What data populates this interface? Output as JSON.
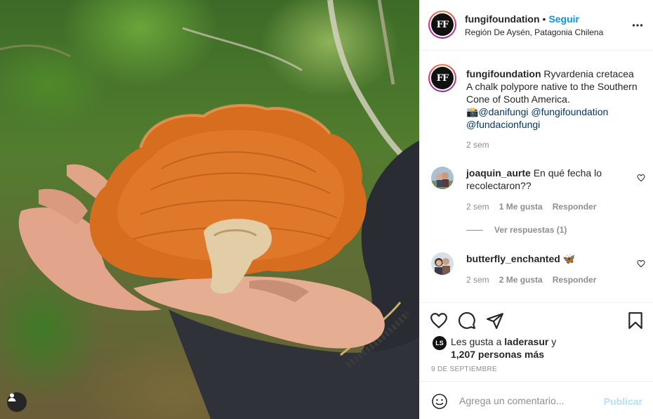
{
  "post": {
    "username": "fungifoundation",
    "avatar_initials": "FF",
    "follow_label": "Seguir",
    "separator": "•",
    "location": "Región De Aysén, Patagonia Chilena"
  },
  "caption": {
    "username": "fungifoundation",
    "line1": "Ryvardenia cretacea",
    "line2": "A chalk polypore native to the Southern Cone of South America.",
    "camera_emoji": "📸",
    "mention1": "@danifungi",
    "mention2": "@fungifoundation",
    "mention3": "@fundacionfungi",
    "time": "2 sem"
  },
  "comments": [
    {
      "username": "joaquin_aurte",
      "text": "En qué fecha lo recolectaron??",
      "time": "2 sem",
      "likes": "1 Me gusta",
      "reply": "Responder",
      "view_replies": "Ver respuestas (1)"
    },
    {
      "username": "butterfly_enchanted",
      "emoji": "🦋",
      "time": "2 sem",
      "likes": "2 Me gusta",
      "reply": "Responder"
    }
  ],
  "likes": {
    "avatar_initials": "LS",
    "prefix": "Les gusta a",
    "user": "laderasur",
    "conj": "y",
    "others": "1,207 personas más"
  },
  "date": "9 DE SEPTIEMBRE",
  "add_comment": {
    "placeholder": "Agrega un comentario...",
    "publish_label": "Publicar"
  },
  "icons": {
    "more": "more-options-icon",
    "heart": "heart-icon",
    "comment": "comment-icon",
    "share": "share-icon",
    "save": "bookmark-icon",
    "emoji": "emoji-icon",
    "profile": "profile-icon"
  },
  "colors": {
    "accent": "#0095f6",
    "publish_disabled": "#b2dffc",
    "muted": "#8e8e8e",
    "mention": "#00376b"
  }
}
